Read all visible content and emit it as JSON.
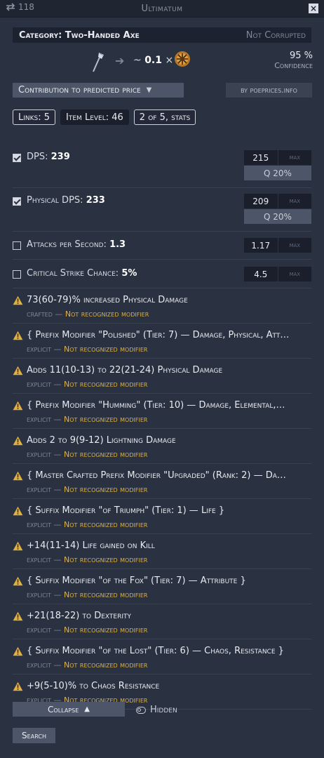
{
  "window": {
    "swap_count": "118",
    "title": "Ultimatum",
    "close": "×"
  },
  "category": {
    "label": "Category: Two-Handed Axe",
    "status": "Not Corrupted"
  },
  "prediction": {
    "prefix": "~",
    "amount": "0.1",
    "times": "×",
    "confidence_value": "95 %",
    "confidence_label": "Confidence"
  },
  "controls": {
    "contribution_label": "Contribution to predicted price",
    "poeprices_label": "by poeprices.info"
  },
  "chips": [
    "Links: 5",
    "Item Level: 46",
    "2 of 5, stats"
  ],
  "stats": [
    {
      "label": "DPS:",
      "value": "239",
      "input": "215",
      "max": "max",
      "quality": "Q 20%",
      "checked": true
    },
    {
      "label": "Physical DPS:",
      "value": "233",
      "input": "209",
      "max": "max",
      "quality": "Q 20%",
      "checked": true
    },
    {
      "label": "Attacks per Second:",
      "value": "1.3",
      "input": "1.17",
      "max": "max",
      "checked": false
    },
    {
      "label": "Critical Strike Chance:",
      "value": "5%",
      "input": "4.5",
      "max": "max",
      "checked": false
    }
  ],
  "mods": [
    {
      "text": "73(60-79)% increased Physical Damage",
      "type": "crafted",
      "status": "Not recognized modifier"
    },
    {
      "text": "{ Prefix Modifier \"Polished\" (Tier: 7) — Damage, Physical, Att…",
      "type": "explicit",
      "status": "Not recognized modifier"
    },
    {
      "text": "Adds 11(10-13) to 22(21-24) Physical Damage",
      "type": "explicit",
      "status": "Not recognized modifier"
    },
    {
      "text": "{ Prefix Modifier \"Humming\" (Tier: 10) — Damage, Elemental,…",
      "type": "explicit",
      "status": "Not recognized modifier"
    },
    {
      "text": "Adds 2 to 9(9-12) Lightning Damage",
      "type": "explicit",
      "status": "Not recognized modifier"
    },
    {
      "text": "{ Master Crafted Prefix Modifier \"Upgraded\" (Rank: 2) — Da…",
      "type": "explicit",
      "status": "Not recognized modifier"
    },
    {
      "text": "{ Suffix Modifier \"of Triumph\" (Tier: 1) — Life }",
      "type": "explicit",
      "status": "Not recognized modifier"
    },
    {
      "text": "+14(11-14) Life gained on Kill",
      "type": "explicit",
      "status": "Not recognized modifier"
    },
    {
      "text": "{ Suffix Modifier \"of the Fox\" (Tier: 7) — Attribute }",
      "type": "explicit",
      "status": "Not recognized modifier"
    },
    {
      "text": "+21(18-22) to Dexterity",
      "type": "explicit",
      "status": "Not recognized modifier"
    },
    {
      "text": "{ Suffix Modifier \"of the Lost\" (Tier: 6) — Chaos, Resistance }",
      "type": "explicit",
      "status": "Not recognized modifier"
    },
    {
      "text": "+9(5-10)% to Chaos Resistance",
      "type": "explicit",
      "status": "Not recognized modifier"
    }
  ],
  "footer": {
    "collapse_label": "Collapse",
    "hidden_label": "Hidden",
    "search_label": "Search"
  },
  "icons": {
    "swap": "swap-icon",
    "close": "close-icon",
    "item": "axe-icon",
    "currency": "chaos-orb-icon",
    "warning": "warning-icon",
    "visibility": "toggle-icon"
  },
  "colors": {
    "background": "#2a3140",
    "warning": "#e0b041",
    "panel": "#1a1f2b",
    "button": "#4d5669"
  }
}
